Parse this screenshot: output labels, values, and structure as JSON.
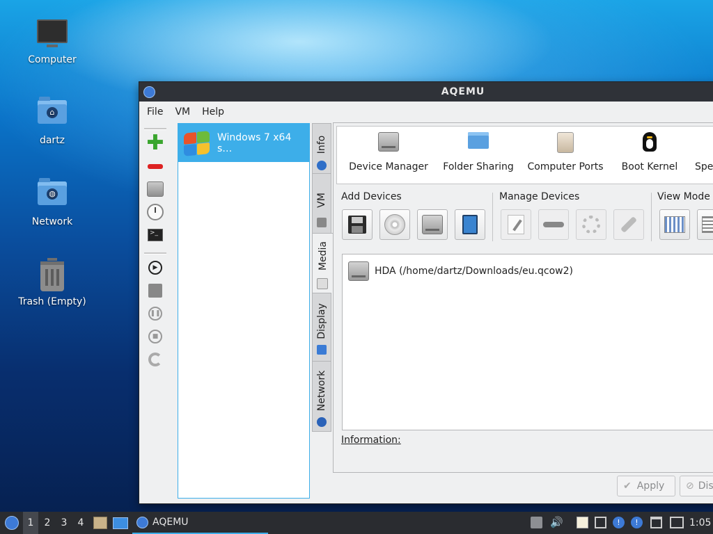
{
  "desktop": {
    "icons": [
      {
        "label": "Computer",
        "icon": "computer-icon"
      },
      {
        "label": "dartz",
        "icon": "home-folder-icon"
      },
      {
        "label": "Network",
        "icon": "network-folder-icon"
      },
      {
        "label": "Trash (Empty)",
        "icon": "trash-icon"
      }
    ]
  },
  "window": {
    "title": "AQEMU",
    "menu": [
      "File",
      "VM",
      "Help"
    ],
    "vm_list": [
      {
        "name": "Windows 7 x64 s…",
        "selected": true
      }
    ],
    "tabs": [
      "Info",
      "VM",
      "Media",
      "Display",
      "Network"
    ],
    "active_tab": "Media",
    "categories": [
      "Device Manager",
      "Folder Sharing",
      "Computer Ports",
      "Boot Kernel",
      "Spec"
    ],
    "sections": {
      "add": "Add Devices",
      "manage": "Manage Devices",
      "view": "View Mode"
    },
    "devices": [
      {
        "label": "HDA (/home/dartz/Downloads/eu.qcow2)"
      }
    ],
    "information_label": "Information:",
    "buttons": {
      "apply": "Apply",
      "discard": "Dis"
    }
  },
  "taskbar": {
    "workspaces": [
      "1",
      "2",
      "3",
      "4"
    ],
    "active_workspace": "1",
    "task": "AQEMU",
    "clock": "1:05"
  },
  "colors": {
    "accent": "#3daee9",
    "titlebar": "#2f3238",
    "taskbar": "#2a2c30"
  }
}
